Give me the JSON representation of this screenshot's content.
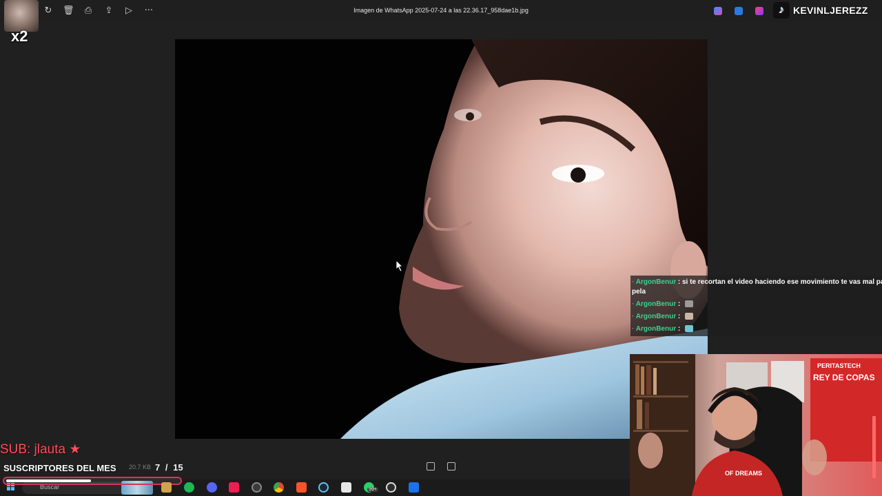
{
  "viewer": {
    "file_title": "Imagen de WhatsApp 2025-07-24 a las 22.36.17_958dae1b.jpg",
    "file_size": "20.7 KB",
    "current_index": "7",
    "separator": "/",
    "total": "15",
    "toolbar_icons": [
      "rotate-icon",
      "delete-icon",
      "print-icon",
      "share-icon",
      "slideshow-icon",
      "more-icon"
    ]
  },
  "overlay": {
    "multiplier": "x2",
    "tiktok_handle": "KEVINLJEREZZ",
    "sub_alert": "SUB: jlauta",
    "subs_title": "SUSCRIPTORES DEL MES",
    "subs_progress": 0.48
  },
  "chat": {
    "messages": [
      {
        "user": "ArgonBenur",
        "text": "si te recortan el video haciendo ese movimiento te vas mal parado",
        "text_cont": "pela"
      },
      {
        "user": "ArgonBenur",
        "text": ""
      },
      {
        "user": "ArgonBenur",
        "text": ""
      },
      {
        "user": "ArgonBenur",
        "text": ""
      }
    ]
  },
  "webcam": {
    "shirt_text": "OF DREAMS",
    "banner_top": "PERITASTECH",
    "banner_main": "REY DE COPAS"
  },
  "taskbar": {
    "search_label": "Buscar",
    "badge": "99+"
  },
  "colors": {
    "chat_user": "#3ad38f",
    "sub_alert": "#ff4d5a",
    "progress_border": "#d4355a"
  }
}
